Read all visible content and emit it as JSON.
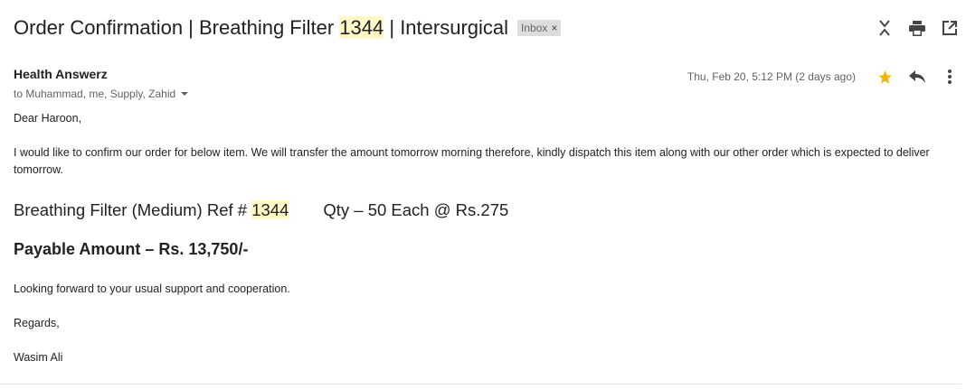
{
  "email": {
    "subject_before": "Order Confirmation | Breathing Filter ",
    "subject_highlight": "1344",
    "subject_after": " | Intersurgical",
    "label": "Inbox",
    "sender": "Health Answerz",
    "recipients": "to Muhammad, me, Supply, Zahid",
    "date": "Thu, Feb 20, 5:12 PM (2 days ago)",
    "greeting": "Dear Haroon,",
    "paragraph1": "I would like to confirm our order for below item. We will transfer the amount tomorrow morning therefore, kindly dispatch this item along with our other order which is expected to deliver tomorrow.",
    "ref_before": "Breathing Filter (Medium) Ref # ",
    "ref_highlight": "1344",
    "qty": "Qty – 50 Each @ Rs.275",
    "payable": "Payable Amount – Rs. 13,750/-",
    "closing": "Looking forward to your usual support and cooperation.",
    "regards": "Regards,",
    "signature": "Wasim Ali"
  },
  "colors": {
    "highlight": "#fff8c5",
    "star": "#f4b400",
    "icon": "#444444"
  },
  "icons": [
    "collapse-all-icon",
    "print-icon",
    "open-in-new-window-icon",
    "star-icon",
    "reply-icon",
    "more-options-icon",
    "chevron-down-icon",
    "close-icon"
  ]
}
